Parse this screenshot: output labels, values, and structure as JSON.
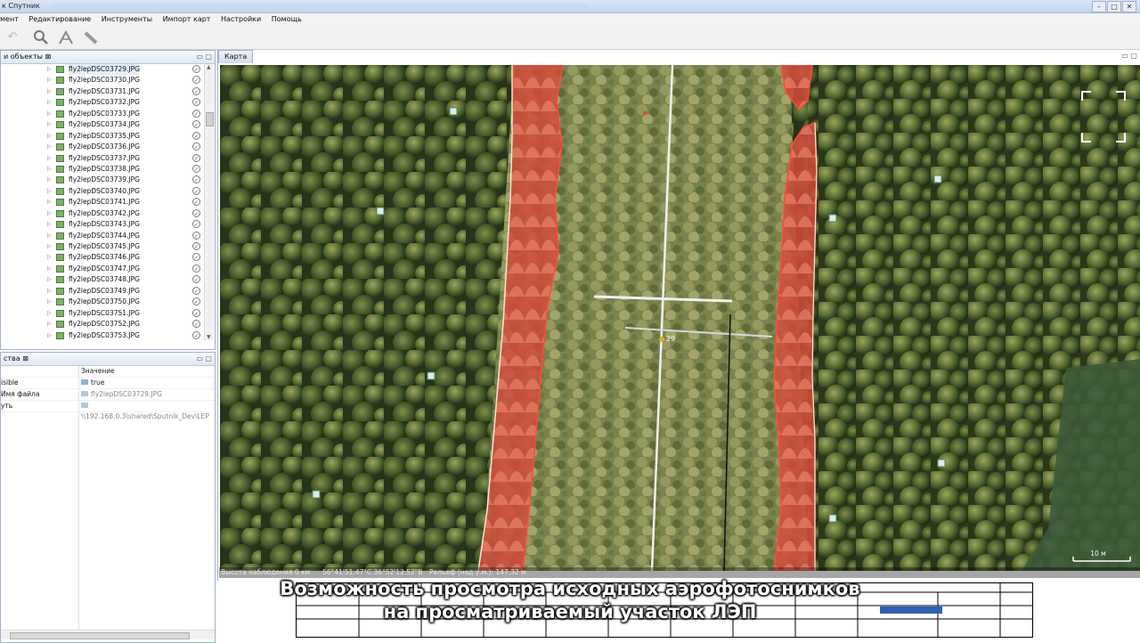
{
  "window": {
    "title": "к Спутник",
    "controls": [
      "–",
      "□",
      "✕"
    ]
  },
  "menu": {
    "items": [
      "мент",
      "Редактирование",
      "Инструменты",
      "Импорт карт",
      "Настройки",
      "Помощь"
    ]
  },
  "toolbar": {
    "icons": [
      "undo-icon",
      "search-icon",
      "path-tool-icon",
      "ruler-icon"
    ]
  },
  "objects_panel": {
    "tab_label": "и объекты",
    "files": [
      "fly2lepDSC03729.JPG",
      "fly2lepDSC03730.JPG",
      "fly2lepDSC03731.JPG",
      "fly2lepDSC03732.JPG",
      "fly2lepDSC03733.JPG",
      "fly2lepDSC03734.JPG",
      "fly2lepDSC03735.JPG",
      "fly2lepDSC03736.JPG",
      "fly2lepDSC03737.JPG",
      "fly2lepDSC03738.JPG",
      "fly2lepDSC03739.JPG",
      "fly2lepDSC03740.JPG",
      "fly2lepDSC03741.JPG",
      "fly2lepDSC03742.JPG",
      "fly2lepDSC03743.JPG",
      "fly2lepDSC03744.JPG",
      "fly2lepDSC03745.JPG",
      "fly2lepDSC03746.JPG",
      "fly2lepDSC03747.JPG",
      "fly2lepDSC03748.JPG",
      "fly2lepDSC03749.JPG",
      "fly2lepDSC03750.JPG",
      "fly2lepDSC03751.JPG",
      "fly2lepDSC03752.JPG",
      "fly2lepDSC03753.JPG"
    ]
  },
  "properties_panel": {
    "tab_label": "ства",
    "header_value": "Значение",
    "rows": [
      {
        "key": "isible",
        "value": "true"
      },
      {
        "key": "Имя файла",
        "value": "fly2lepDSC03729.JPG"
      },
      {
        "key": "уть",
        "value": "\\\\192.168.0.3\\shared\\Sputnik_Dev\\LEP"
      }
    ]
  },
  "map": {
    "tab_label": "Карта",
    "tower_label": "29",
    "status": {
      "altitude": "Высота наблюдения 0 км",
      "coordinates": "56°41'51.47\"С 36°52'12.52\"В",
      "relief": "Рельеф (над у.м.): 147,32 м"
    },
    "scale_label": "10 м"
  },
  "caption": {
    "line1": "Возможность просмотра исходных аэрофотоснимков",
    "line2": "на просматриваемый участок ЛЭП"
  },
  "colors": {
    "danger_zone": "#d9473a",
    "forest_dark": "#2f3f1c",
    "corridor": "#8a9557"
  }
}
